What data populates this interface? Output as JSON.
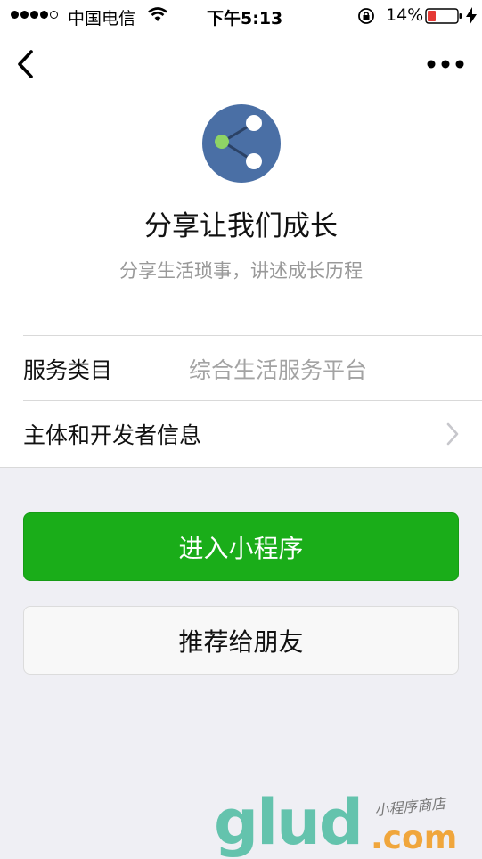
{
  "status_bar": {
    "carrier": "中国电信",
    "time": "下午5:13",
    "battery_percent": "14%",
    "battery_level": 0.14,
    "signal_bars": 4,
    "icons": [
      "wifi-icon",
      "orientation-lock-icon",
      "battery-icon",
      "charging-icon"
    ]
  },
  "nav": {
    "back_icon": "chevron-left-icon",
    "more_icon": "more-dots-icon"
  },
  "profile": {
    "logo_icon": "share-icon",
    "name": "分享让我们成长",
    "description": "分享生活琐事，讲述成长历程"
  },
  "info": {
    "category_label": "服务类目",
    "category_value": "综合生活服务平台",
    "developer_label": "主体和开发者信息"
  },
  "buttons": {
    "enter": "进入小程序",
    "recommend": "推荐给朋友"
  },
  "colors": {
    "primary_green": "#1aad19",
    "logo_blue": "#4a6fa5",
    "logo_accent": "#8ed465"
  },
  "watermark": {
    "brand": "glud",
    "domain": ".com",
    "slogan": "小程序商店"
  }
}
